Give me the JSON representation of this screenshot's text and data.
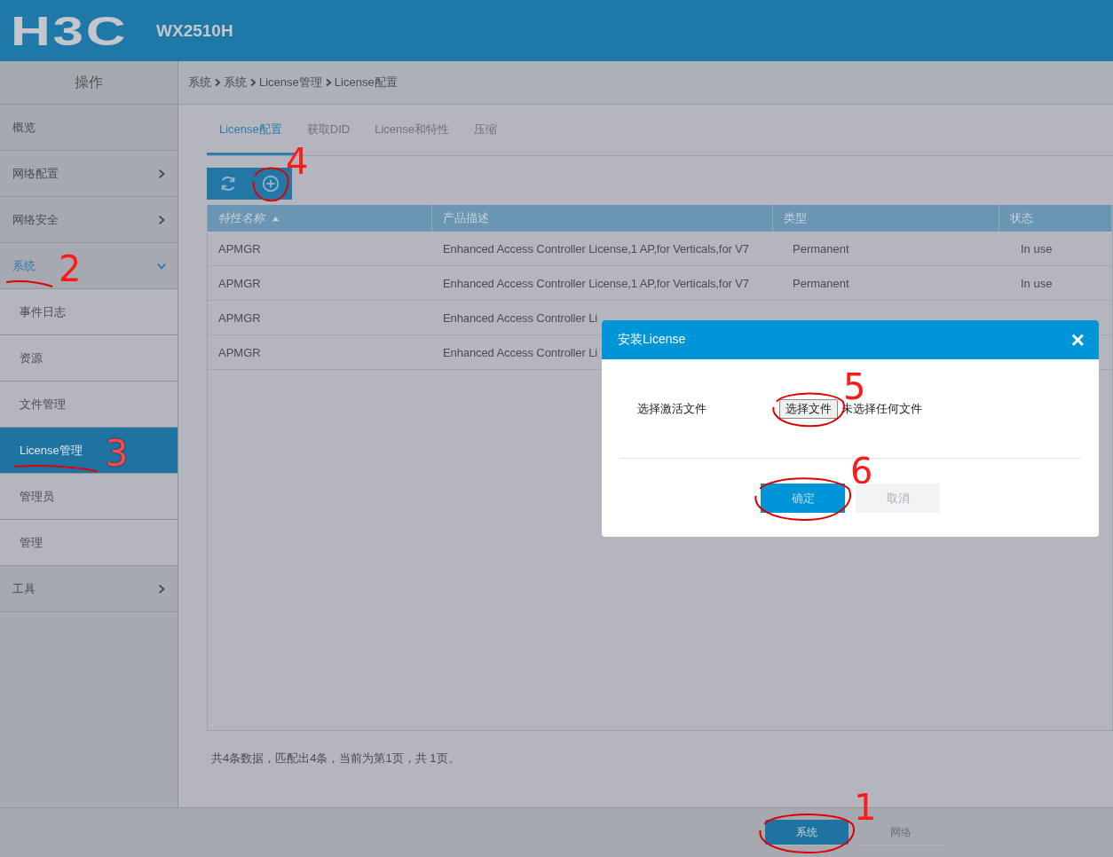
{
  "header": {
    "logo": "H3C",
    "model": "WX2510H"
  },
  "sidebar": {
    "title": "操作",
    "items": [
      {
        "label": "概览"
      },
      {
        "label": "网络配置",
        "expanded": false
      },
      {
        "label": "网络安全",
        "expanded": false
      },
      {
        "label": "系统",
        "expanded": true,
        "annotation": {
          "label": "2",
          "kind": "underline"
        },
        "children": [
          {
            "label": "事件日志",
            "selected": false
          },
          {
            "label": "资源",
            "selected": false
          },
          {
            "label": "文件管理",
            "selected": false
          },
          {
            "label": "License管理",
            "selected": true,
            "annotation": {
              "label": "3",
              "kind": "underline"
            }
          },
          {
            "label": "管理员",
            "selected": false
          },
          {
            "label": "管理",
            "selected": false
          }
        ]
      },
      {
        "label": "工具",
        "expanded": false
      }
    ]
  },
  "breadcrumb": [
    "系统",
    "系统",
    "License管理",
    "License配置"
  ],
  "tabs": [
    {
      "label": "License配置",
      "selected": true
    },
    {
      "label": "获取DID",
      "selected": false
    },
    {
      "label": "License和特性",
      "selected": false
    },
    {
      "label": "压缩",
      "selected": false
    }
  ],
  "toolbar": [
    {
      "kind": "refresh"
    },
    {
      "kind": "add",
      "annotation": {
        "label": "4",
        "kind": "circle"
      }
    }
  ],
  "table": {
    "columns": [
      {
        "label": "特性名称",
        "sorted": true
      },
      {
        "label": "产品描述",
        "sorted": false
      },
      {
        "label": "类型",
        "sorted": false
      },
      {
        "label": "状态",
        "sorted": false
      }
    ],
    "rows": [
      [
        "APMGR",
        "Enhanced Access Controller License,1 AP,for Verticals,for V7",
        "Permanent",
        "In use"
      ],
      [
        "APMGR",
        "Enhanced Access Controller License,1 AP,for Verticals,for V7",
        "Permanent",
        "In use"
      ],
      [
        "APMGR",
        "Enhanced Access Controller Li"
      ],
      [
        "APMGR",
        "Enhanced Access Controller Li"
      ]
    ]
  },
  "summary": "共4条数据，匹配出4条，当前为第1页，共 1页。",
  "bottom_tabs": [
    {
      "label": "系统",
      "selected": true,
      "annotation": {
        "label": "1",
        "kind": "circle"
      }
    },
    {
      "label": "网络",
      "selected": false
    }
  ],
  "dialog": {
    "title": "安装License",
    "close": "×",
    "field_label": "选择激活文件",
    "file_button": {
      "label": "选择文件",
      "annotation": {
        "label": "5",
        "kind": "circle"
      }
    },
    "file_status": "未选择任何文件",
    "buttons": [
      {
        "label": "确定",
        "kind": "primary",
        "annotation": {
          "label": "6",
          "kind": "circle"
        }
      },
      {
        "label": "取消",
        "kind": "secondary"
      }
    ]
  }
}
